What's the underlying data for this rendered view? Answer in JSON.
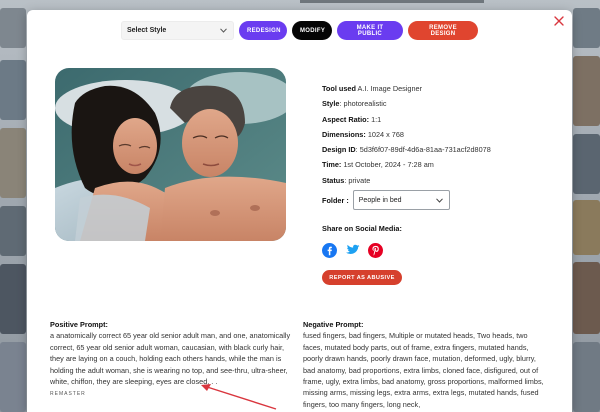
{
  "toolbar": {
    "style_select": "Select Style",
    "redesign": "REDESIGN",
    "modify": "MODIFY",
    "make_public": "MAKE IT PUBLIC",
    "remove": "REMOVE DESIGN"
  },
  "meta": {
    "tool_label": "Tool used",
    "tool_value": "A.I. Image Designer",
    "style_label": "Style",
    "style_value": "photorealistic",
    "aspect_label": "Aspect Ratio:",
    "aspect_value": "1:1",
    "dimensions_label": "Dimensions:",
    "dimensions_value": "1024 x 768",
    "design_id_label": "Design ID",
    "design_id_value": "5d3f6f07-89df-4d6a-81aa-731acf2d8078",
    "time_label": "Time:",
    "time_value": "1st October, 2024 - 7:28 am",
    "status_label": "Status",
    "status_value": "private",
    "folder_label": "Folder :",
    "folder_value": "People in bed"
  },
  "share": {
    "title": "Share on Social Media:",
    "icons": [
      "facebook-icon",
      "twitter-icon",
      "pinterest-icon"
    ]
  },
  "report_button": "REPORT AS ABUSIVE",
  "positive_prompt": {
    "title": "Positive Prompt:",
    "text": "a anatomically correct 65 year old senior adult man, and one, anatomically correct, 65 year old senior adult woman, caucasian, with black curly hair, they are laying on a couch, holding each others hands, while the man is holding the adult woman, she is wearing no top, and see-thru, ultra-sheer, white, chiffon, they are sleeping, eyes are closed, . .",
    "cut_line": "REMASTER"
  },
  "negative_prompt": {
    "title": "Negative Prompt:",
    "text": "fused fingers, bad fingers, Multiple or mutated heads, Two heads, two faces, mutated body parts, out of frame, extra fingers, mutated hands, poorly drawn hands, poorly drawn face, mutation, deformed, ugly, blurry, bad anatomy, bad proportions, extra limbs, cloned face, disfigured, out of frame, ugly, extra limbs, bad anatomy, gross proportions, malformed limbs, missing arms, missing legs, extra arms, extra legs, mutated hands, fused fingers, too many fingers, long neck,"
  },
  "colors": {
    "purple": "#6a3cf0",
    "black": "#050505",
    "red": "#e0452f",
    "report_red": "#d6402d",
    "close_red": "#d9363e",
    "arrow_red": "#d9363e"
  }
}
